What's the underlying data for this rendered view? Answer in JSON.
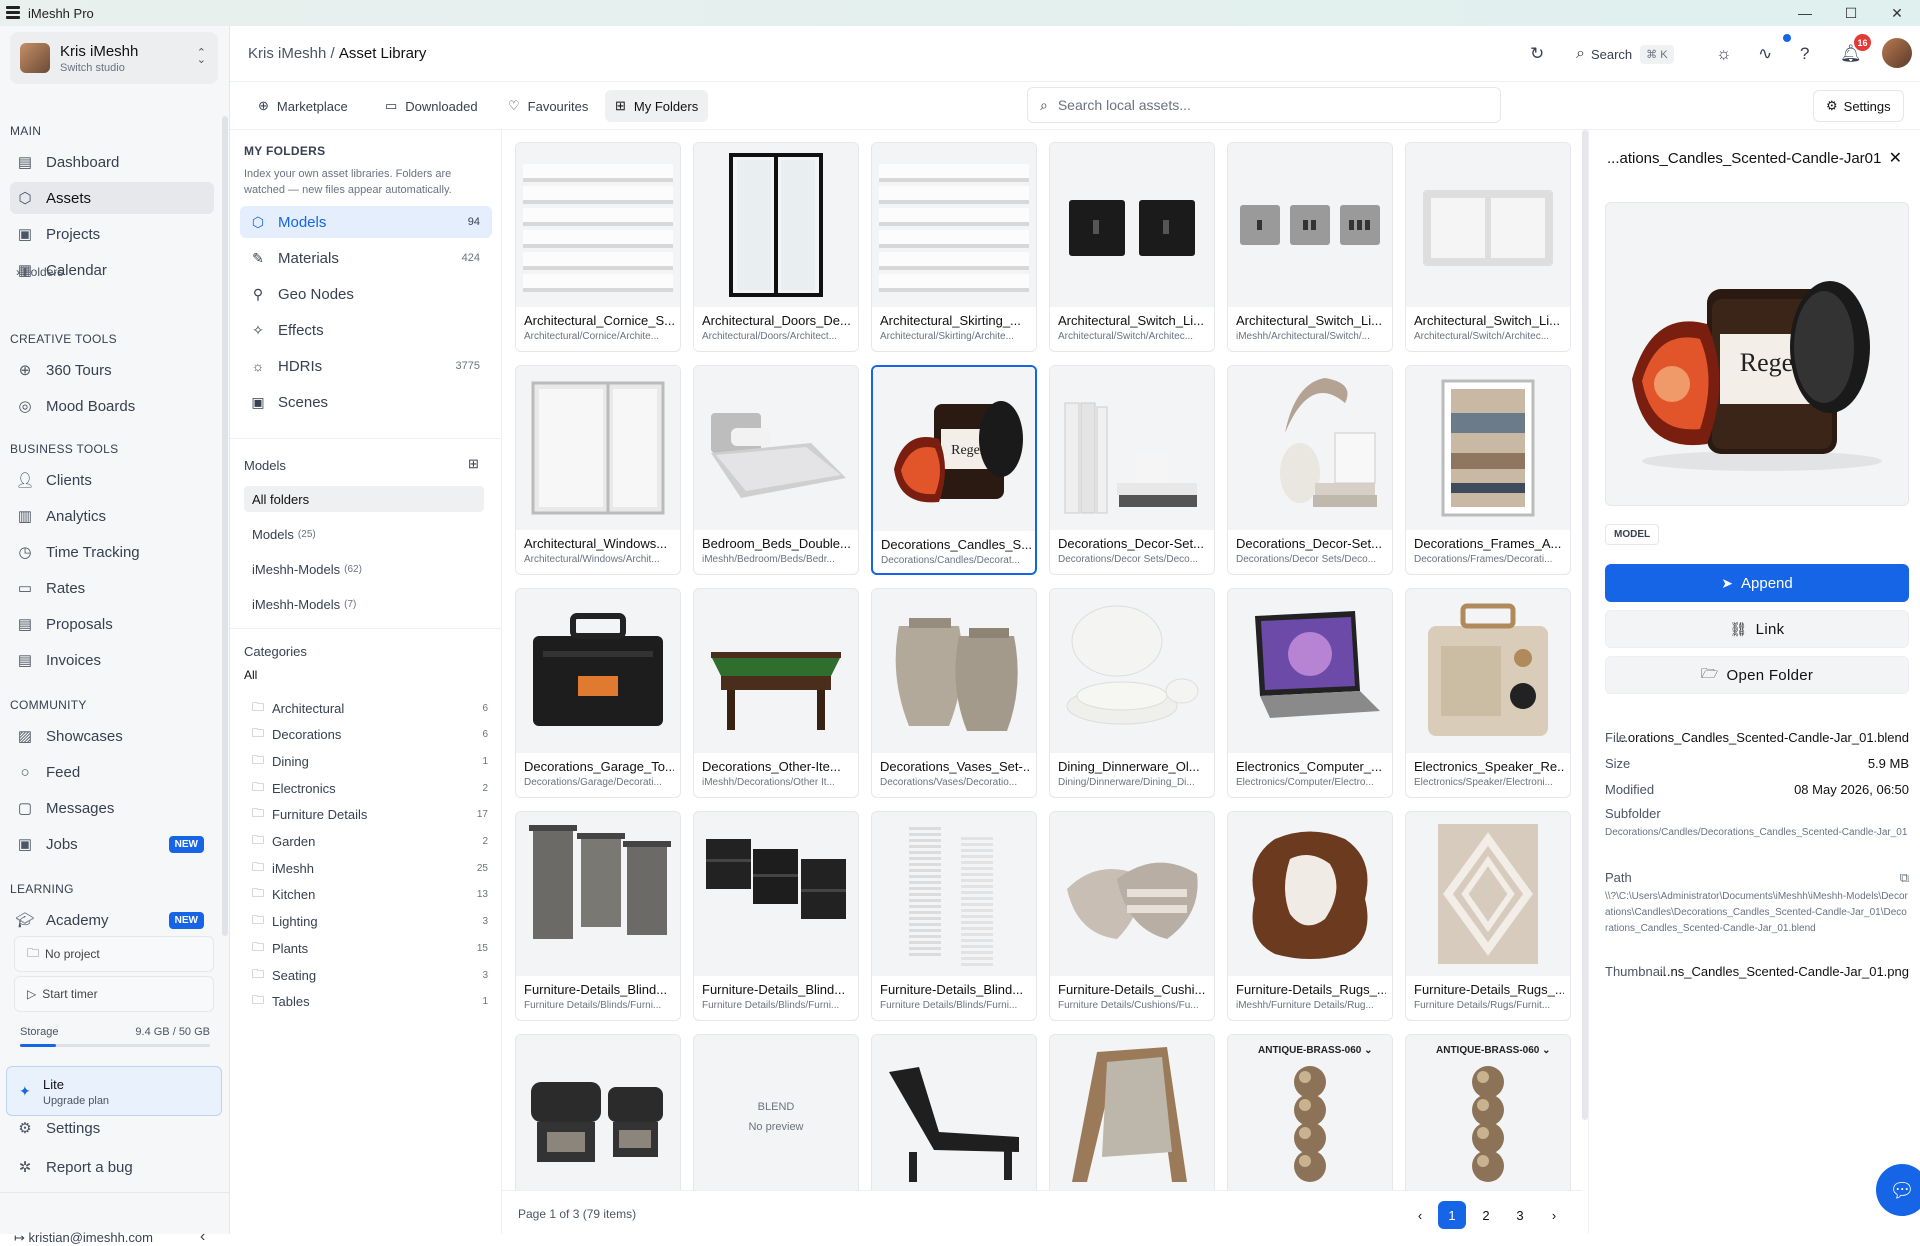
{
  "window": {
    "title": "iMeshh Pro",
    "minimize": "—",
    "maximize": "☐",
    "close": "✕"
  },
  "workspace": {
    "name": "Kris iMeshh",
    "subtitle": "Switch studio"
  },
  "sidebar": {
    "sections": [
      {
        "label": "MAIN",
        "items": [
          {
            "label": "Dashboard"
          },
          {
            "label": "Assets",
            "active": true
          },
          {
            "label": "Projects"
          },
          {
            "label": "Calendar"
          }
        ]
      },
      {
        "label": "CREATIVE TOOLS",
        "items": [
          {
            "label": "360 Tours"
          },
          {
            "label": "Mood Boards"
          }
        ]
      },
      {
        "label": "BUSINESS TOOLS",
        "items": [
          {
            "label": "Clients"
          },
          {
            "label": "Analytics"
          },
          {
            "label": "Time Tracking"
          },
          {
            "label": "Rates"
          },
          {
            "label": "Proposals"
          },
          {
            "label": "Invoices"
          }
        ]
      },
      {
        "label": "COMMUNITY",
        "items": [
          {
            "label": "Showcases"
          },
          {
            "label": "Feed"
          },
          {
            "label": "Messages"
          },
          {
            "label": "Jobs",
            "badge": "NEW"
          }
        ]
      },
      {
        "label": "LEARNING",
        "items": [
          {
            "label": "Academy",
            "badge": "NEW"
          }
        ]
      }
    ],
    "folders_sub": "Folders",
    "no_project": "No project",
    "start_timer": "Start timer",
    "storage_label": "Storage",
    "storage_value": "9.4 GB / 50 GB",
    "storage_fraction": 0.188,
    "plan_title": "Lite",
    "plan_sub": "Upgrade plan",
    "settings": "Settings",
    "report_bug": "Report a bug",
    "email": "kristian@imeshh.com"
  },
  "header": {
    "crumb_root": "Kris iMeshh",
    "crumb_sep": " / ",
    "crumb_current": "Asset Library",
    "search_label": "Search",
    "search_kbd": "⌘ K",
    "notif_count": "16"
  },
  "tabs": [
    {
      "label": "Marketplace"
    },
    {
      "label": "Downloaded"
    },
    {
      "label": "Favourites"
    },
    {
      "label": "My Folders",
      "active": true
    }
  ],
  "local_search": {
    "placeholder": "Search local assets..."
  },
  "settings_btn": "Settings",
  "folders_panel": {
    "title": "MY FOLDERS",
    "description": "Index your own asset libraries. Folders are watched — new files appear automatically.",
    "libraries": [
      {
        "label": "Models",
        "count": "94",
        "active": true
      },
      {
        "label": "Materials",
        "count": "424"
      },
      {
        "label": "Geo Nodes",
        "count": ""
      },
      {
        "label": "Effects",
        "count": ""
      },
      {
        "label": "HDRIs",
        "count": "3775"
      },
      {
        "label": "Scenes",
        "count": ""
      }
    ],
    "models_heading": "Models",
    "folders": [
      {
        "label": "All folders",
        "count": "",
        "active": true
      },
      {
        "label": "Models",
        "count": "(25)"
      },
      {
        "label": "iMeshh-Models",
        "count": "(62)"
      },
      {
        "label": "iMeshh-Models",
        "count": "(7)"
      }
    ],
    "categories_heading": "Categories",
    "categories_all": "All",
    "categories": [
      {
        "label": "Architectural",
        "count": "6"
      },
      {
        "label": "Decorations",
        "count": "6"
      },
      {
        "label": "Dining",
        "count": "1"
      },
      {
        "label": "Electronics",
        "count": "2"
      },
      {
        "label": "Furniture Details",
        "count": "17"
      },
      {
        "label": "Garden",
        "count": "2"
      },
      {
        "label": "iMeshh",
        "count": "25"
      },
      {
        "label": "Kitchen",
        "count": "13"
      },
      {
        "label": "Lighting",
        "count": "3"
      },
      {
        "label": "Plants",
        "count": "15"
      },
      {
        "label": "Seating",
        "count": "3"
      },
      {
        "label": "Tables",
        "count": "1"
      }
    ]
  },
  "assets": [
    {
      "name": "Architectural_Cornice_S...",
      "path": "Architectural/Cornice/Archite...",
      "kind": "cornice"
    },
    {
      "name": "Architectural_Doors_De...",
      "path": "Architectural/Doors/Architect...",
      "kind": "door"
    },
    {
      "name": "Architectural_Skirting_...",
      "path": "Architectural/Skirting/Archite...",
      "kind": "cornice"
    },
    {
      "name": "Architectural_Switch_Li...",
      "path": "Architectural/Switch/Architec...",
      "kind": "switchdark"
    },
    {
      "name": "Architectural_Switch_Li...",
      "path": "iMeshh/Architectural/Switch/...",
      "kind": "switchgrey"
    },
    {
      "name": "Architectural_Switch_Li...",
      "path": "Architectural/Switch/Architec...",
      "kind": "switchwhite"
    },
    {
      "name": "Architectural_Windows...",
      "path": "Architectural/Windows/Archit...",
      "kind": "window"
    },
    {
      "name": "Bedroom_Beds_Double...",
      "path": "iMeshh/Bedroom/Beds/Bedr...",
      "kind": "bed"
    },
    {
      "name": "Decorations_Candles_S...",
      "path": "Decorations/Candles/Decorat...",
      "kind": "candle",
      "selected": true
    },
    {
      "name": "Decorations_Decor-Set...",
      "path": "Decorations/Decor Sets/Deco...",
      "kind": "books"
    },
    {
      "name": "Decorations_Decor-Set...",
      "path": "Decorations/Decor Sets/Deco...",
      "kind": "vase"
    },
    {
      "name": "Decorations_Frames_A...",
      "path": "Decorations/Frames/Decorati...",
      "kind": "frame"
    },
    {
      "name": "Decorations_Garage_To...",
      "path": "Decorations/Garage/Decorati...",
      "kind": "toolbox"
    },
    {
      "name": "Decorations_Other-Ite...",
      "path": "iMeshh/Decorations/Other It...",
      "kind": "pool"
    },
    {
      "name": "Decorations_Vases_Set-...",
      "path": "Decorations/Vases/Decoratio...",
      "kind": "urns"
    },
    {
      "name": "Dining_Dinnerware_Ol...",
      "path": "Dining/Dinnerware/Dining_Di...",
      "kind": "plates"
    },
    {
      "name": "Electronics_Computer_...",
      "path": "Electronics/Computer/Electro...",
      "kind": "laptop"
    },
    {
      "name": "Electronics_Speaker_Re...",
      "path": "Electronics/Speaker/Electroni...",
      "kind": "speaker"
    },
    {
      "name": "Furniture-Details_Blind...",
      "path": "Furniture Details/Blinds/Furni...",
      "kind": "blinds"
    },
    {
      "name": "Furniture-Details_Blind...",
      "path": "Furniture Details/Blinds/Furni...",
      "kind": "blindsdark"
    },
    {
      "name": "Furniture-Details_Blind...",
      "path": "Furniture Details/Blinds/Furni...",
      "kind": "venetian"
    },
    {
      "name": "Furniture-Details_Cushi...",
      "path": "Furniture Details/Cushions/Fu...",
      "kind": "cushions"
    },
    {
      "name": "Furniture-Details_Rugs_...",
      "path": "iMeshh/Furniture Details/Rug...",
      "kind": "cowhide"
    },
    {
      "name": "Furniture-Details_Rugs_...",
      "path": "Furniture Details/Rugs/Furnit...",
      "kind": "rug"
    },
    {
      "name": "",
      "path": "",
      "kind": "grill"
    },
    {
      "name": "",
      "path": "",
      "kind": "blend",
      "line1": "BLEND",
      "line2": "No preview"
    },
    {
      "name": "",
      "path": "",
      "kind": "lounger"
    },
    {
      "name": "",
      "path": "",
      "kind": "deckchair"
    },
    {
      "name": "",
      "path": "",
      "kind": "brass",
      "chip": "ANTIQUE-BRASS-060"
    },
    {
      "name": "",
      "path": "",
      "kind": "brass",
      "chip": "ANTIQUE-BRASS-060"
    }
  ],
  "pager": {
    "info": "Page 1 of 3 (79 items)",
    "pages": [
      "1",
      "2",
      "3"
    ],
    "prev": "‹",
    "next": "›"
  },
  "detail": {
    "title": "...ations_Candles_Scented-Candle-Jar01",
    "image_label": "Regen",
    "tag": "MODEL",
    "append": "Append",
    "link": "Link",
    "open_folder": "Open Folder",
    "file_label": "File",
    "file_value": "...orations_Candles_Scented-Candle-Jar_01.blend",
    "size_label": "Size",
    "size_value": "5.9 MB",
    "modified_label": "Modified",
    "modified_value": "08 May 2026, 06:50",
    "subfolder_label": "Subfolder",
    "subfolder_value": "Decorations/Candles/Decorations_Candles_Scented-Candle-Jar_01",
    "path_label": "Path",
    "path_value": "\\\\?\\C:\\Users\\Administrator\\Documents\\iMeshh\\iMeshh-Models\\Decorations\\Candles\\Decorations_Candles_Scented-Candle-Jar_01\\Decorations_Candles_Scented-Candle-Jar_01.blend",
    "thumb_label": "Thumbnail",
    "thumb_value": "...ns_Candles_Scented-Candle-Jar_01.png"
  },
  "colors": {
    "accent": "#1565e6",
    "badge": "#e53935"
  }
}
